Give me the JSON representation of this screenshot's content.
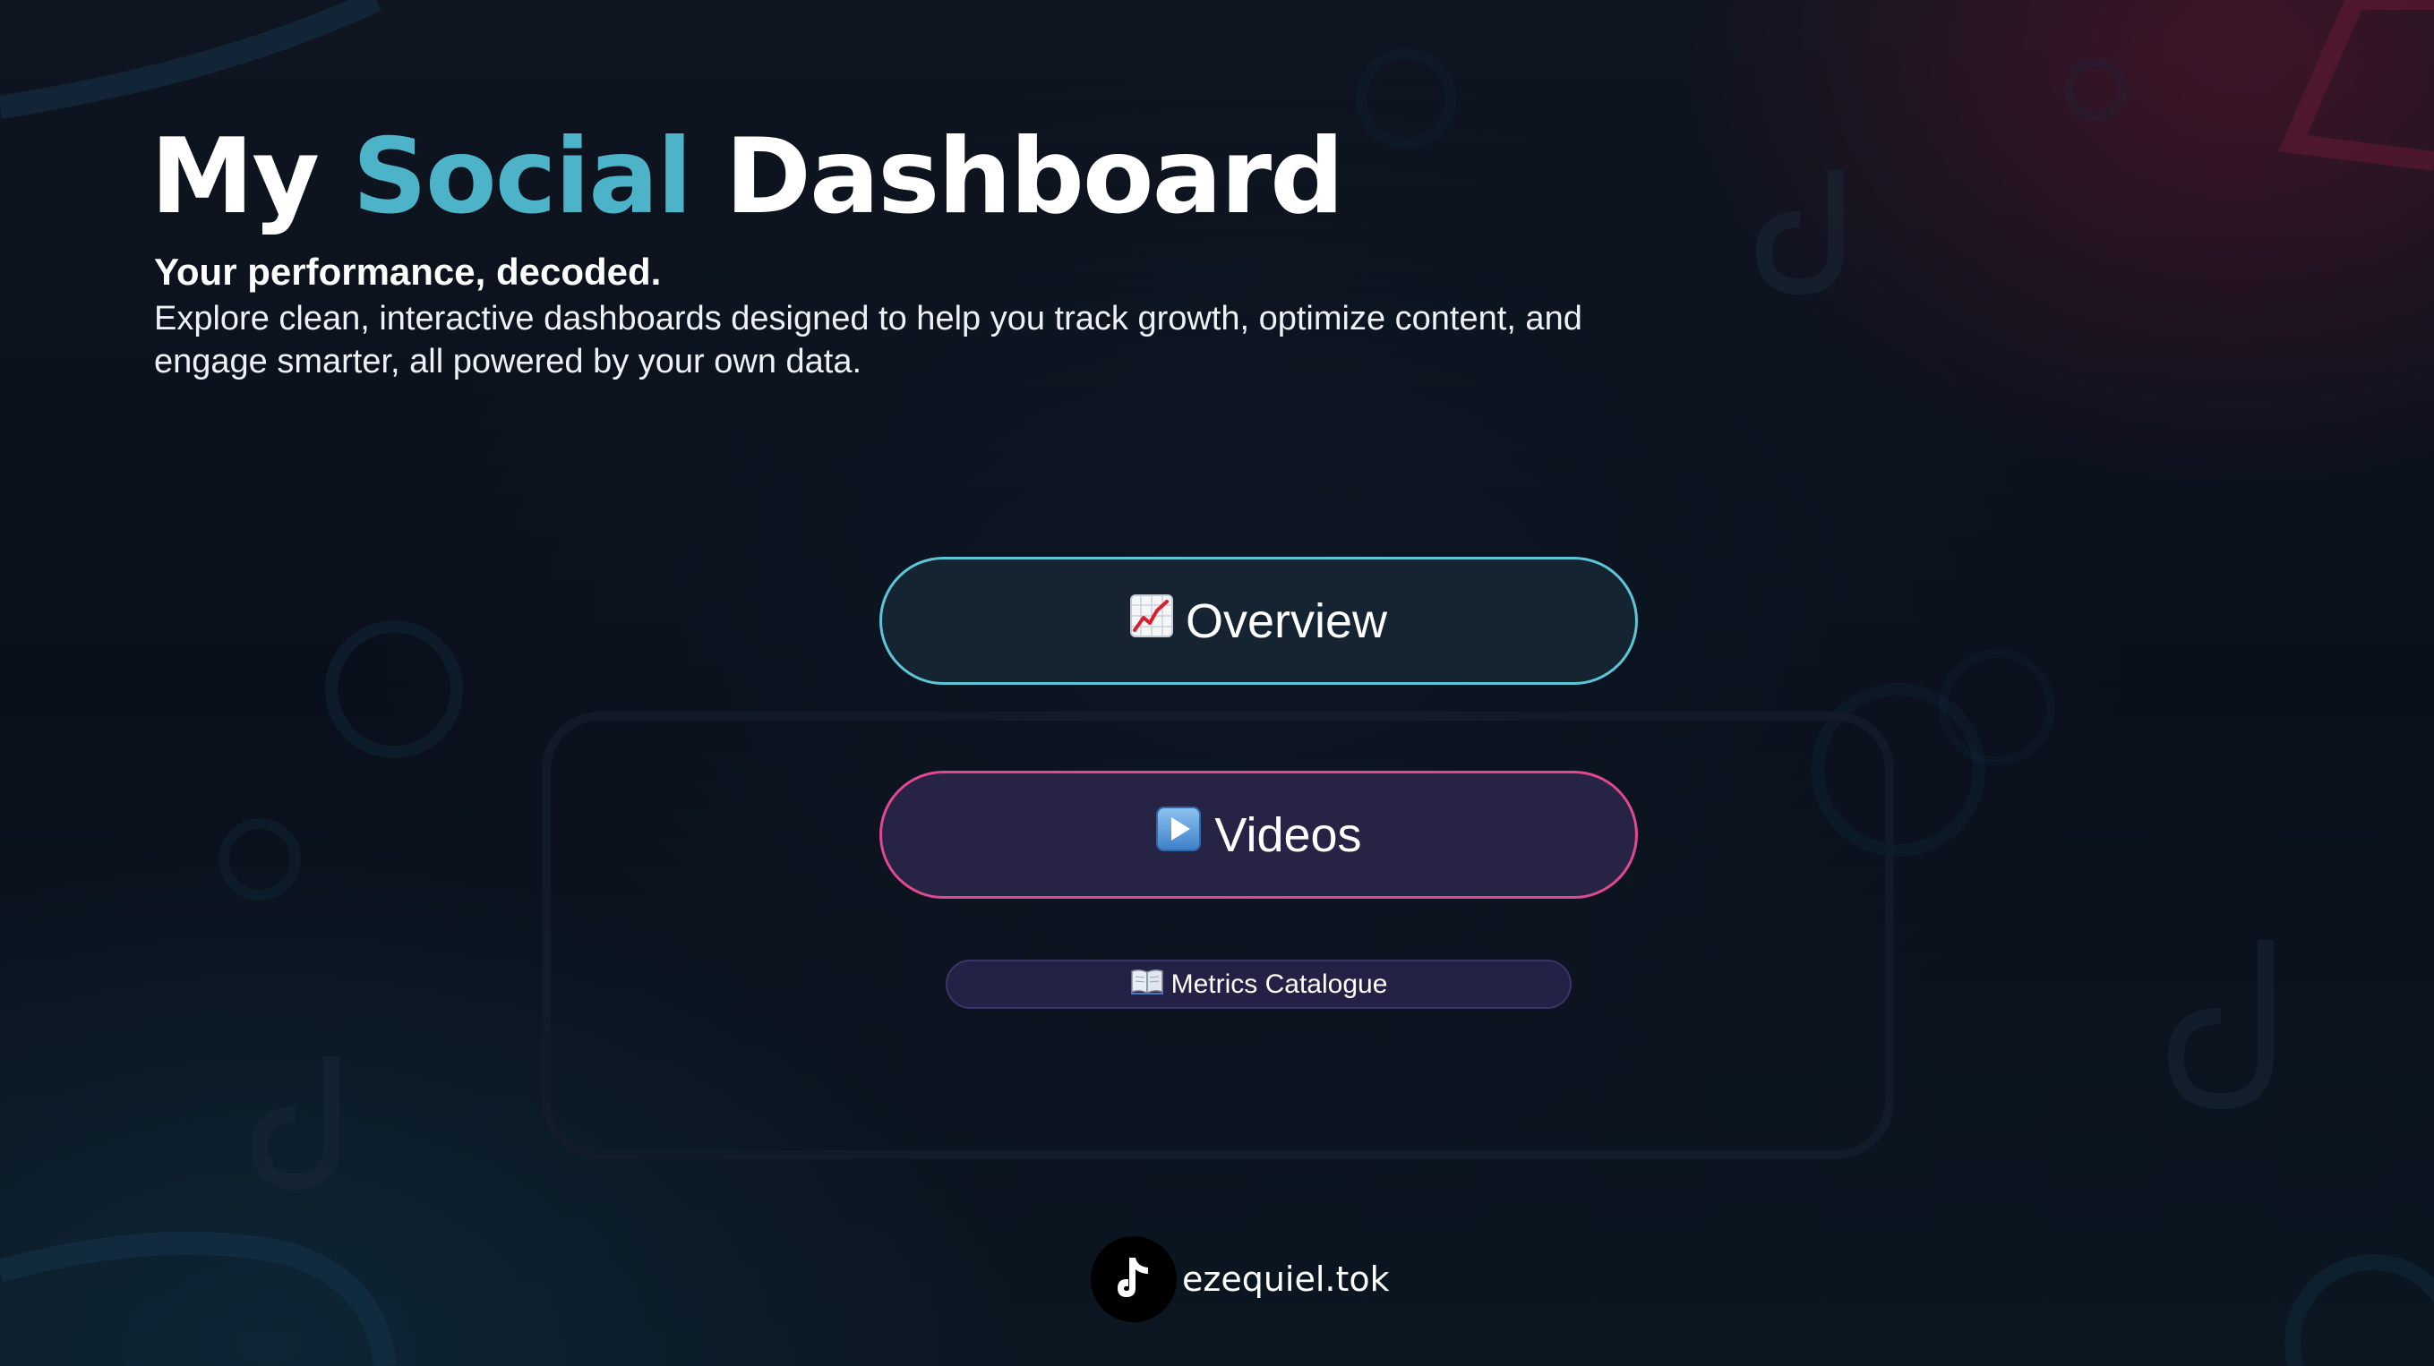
{
  "header": {
    "title_part1": "My",
    "title_accent": "Social",
    "title_part2": "Dashboard",
    "tagline": "Your performance, decoded.",
    "description": "Explore clean, interactive dashboards designed to help you track growth, optimize content, and engage smarter,  all powered by your own data."
  },
  "nav": {
    "overview": {
      "label": "Overview",
      "icon": "chart-increasing-icon"
    },
    "videos": {
      "label": "Videos",
      "icon": "play-button-icon"
    },
    "catalogue": {
      "label": "Metrics Catalogue",
      "icon": "open-book-icon"
    }
  },
  "footer": {
    "handle": "ezequiel.tok",
    "icon": "tiktok-logo-icon"
  },
  "colors": {
    "accent_teal": "#4db3c8",
    "overview_border": "#5cc6d6",
    "videos_border": "#e0488f",
    "background": "#0b111d"
  }
}
